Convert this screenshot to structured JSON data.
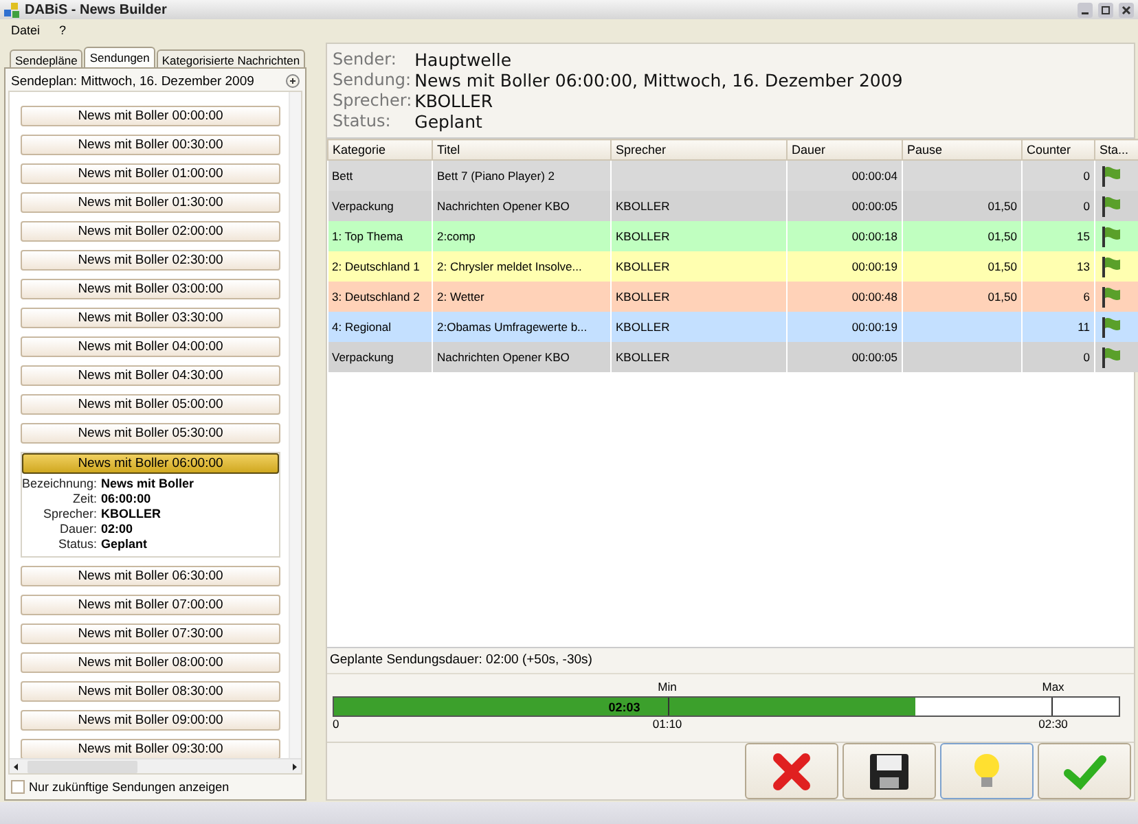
{
  "window": {
    "title": "DABiS - News Builder"
  },
  "menu": [
    "Datei",
    "?"
  ],
  "left_panel": {
    "tabs": [
      {
        "label": "Sendepläne",
        "selected": false
      },
      {
        "label": "Sendungen",
        "selected": true
      },
      {
        "label": "Kategorisierte Nachrichten",
        "selected": false
      }
    ],
    "header": "Sendeplan: Mittwoch, 16. Dezember 2009",
    "broadcasts": [
      {
        "label": "News mit Boller 00:00:00",
        "selected": false
      },
      {
        "label": "News mit Boller 00:30:00",
        "selected": false
      },
      {
        "label": "News mit Boller 01:00:00",
        "selected": false
      },
      {
        "label": "News mit Boller 01:30:00",
        "selected": false
      },
      {
        "label": "News mit Boller 02:00:00",
        "selected": false
      },
      {
        "label": "News mit Boller 02:30:00",
        "selected": false
      },
      {
        "label": "News mit Boller 03:00:00",
        "selected": false
      },
      {
        "label": "News mit Boller 03:30:00",
        "selected": false
      },
      {
        "label": "News mit Boller 04:00:00",
        "selected": false
      },
      {
        "label": "News mit Boller 04:30:00",
        "selected": false
      },
      {
        "label": "News mit Boller 05:00:00",
        "selected": false
      },
      {
        "label": "News mit Boller 05:30:00",
        "selected": false
      },
      {
        "label": "News mit Boller 06:00:00",
        "selected": true,
        "details": [
          {
            "label": "Bezeichnung:",
            "value": "News mit Boller"
          },
          {
            "label": "Zeit:",
            "value": "06:00:00"
          },
          {
            "label": "Sprecher:",
            "value": "KBOLLER"
          },
          {
            "label": "Dauer:",
            "value": "02:00"
          },
          {
            "label": "Status:",
            "value": "Geplant"
          }
        ]
      },
      {
        "label": "News mit Boller 06:30:00",
        "selected": false
      },
      {
        "label": "News mit Boller 07:00:00",
        "selected": false
      },
      {
        "label": "News mit Boller 07:30:00",
        "selected": false
      },
      {
        "label": "News mit Boller 08:00:00",
        "selected": false
      },
      {
        "label": "News mit Boller 08:30:00",
        "selected": false
      },
      {
        "label": "News mit Boller 09:00:00",
        "selected": false
      },
      {
        "label": "News mit Boller 09:30:00",
        "selected": false
      }
    ],
    "future_only": {
      "label": "Nur zukünftige Sendungen anzeigen",
      "checked": false
    }
  },
  "info": [
    {
      "label": "Sender:",
      "value": "Hauptwelle"
    },
    {
      "label": "Sendung:",
      "value": "News mit Boller 06:00:00, Mittwoch, 16. Dezember 2009"
    },
    {
      "label": "Sprecher:",
      "value": "KBOLLER"
    },
    {
      "label": "Status:",
      "value": "Geplant"
    }
  ],
  "table": {
    "columns": [
      "Kategorie",
      "Titel",
      "Sprecher",
      "Dauer",
      "Pause",
      "Counter",
      "Sta..."
    ],
    "rows": [
      {
        "color": "#d9d9d9",
        "cells": [
          "Bett",
          "Bett 7 (Piano Player) 2",
          "",
          "00:00:04",
          "",
          "0"
        ]
      },
      {
        "color": "#d3d3d3",
        "cells": [
          "Verpackung",
          "Nachrichten Opener KBO",
          "KBOLLER",
          "00:00:05",
          "01,50",
          "0"
        ]
      },
      {
        "color": "#c0ffc0",
        "cells": [
          "1: Top Thema",
          "2:comp",
          "KBOLLER",
          "00:00:18",
          "01,50",
          "15"
        ]
      },
      {
        "color": "#ffffb0",
        "cells": [
          "2: Deutschland 1",
          "2: Chrysler meldet Insolve...",
          "KBOLLER",
          "00:00:19",
          "01,50",
          "13"
        ]
      },
      {
        "color": "#ffd2b8",
        "cells": [
          "3: Deutschland 2",
          "2: Wetter",
          "KBOLLER",
          "00:00:48",
          "01,50",
          "6"
        ]
      },
      {
        "color": "#c4e0ff",
        "cells": [
          "4: Regional",
          "2:Obamas Umfragewerte b...",
          "KBOLLER",
          "00:00:19",
          "",
          "11"
        ]
      },
      {
        "color": "#d3d3d3",
        "cells": [
          "Verpackung",
          "Nachrichten Opener KBO",
          "KBOLLER",
          "00:00:05",
          "",
          "0"
        ]
      }
    ]
  },
  "duration": {
    "label": "Geplante Sendungsdauer:  02:00 (+50s, -30s)",
    "value": "02:03",
    "level": 0.74,
    "start": "0",
    "markers": [
      {
        "top": "Min",
        "bottom": "01:10",
        "level": 0.425
      },
      {
        "top": "Max",
        "bottom": "02:30",
        "level": 0.915
      }
    ]
  },
  "actions": [
    {
      "kind": "cancel",
      "focused": false
    },
    {
      "kind": "save",
      "focused": false
    },
    {
      "kind": "hint",
      "focused": true
    },
    {
      "kind": "confirm",
      "focused": false
    }
  ]
}
